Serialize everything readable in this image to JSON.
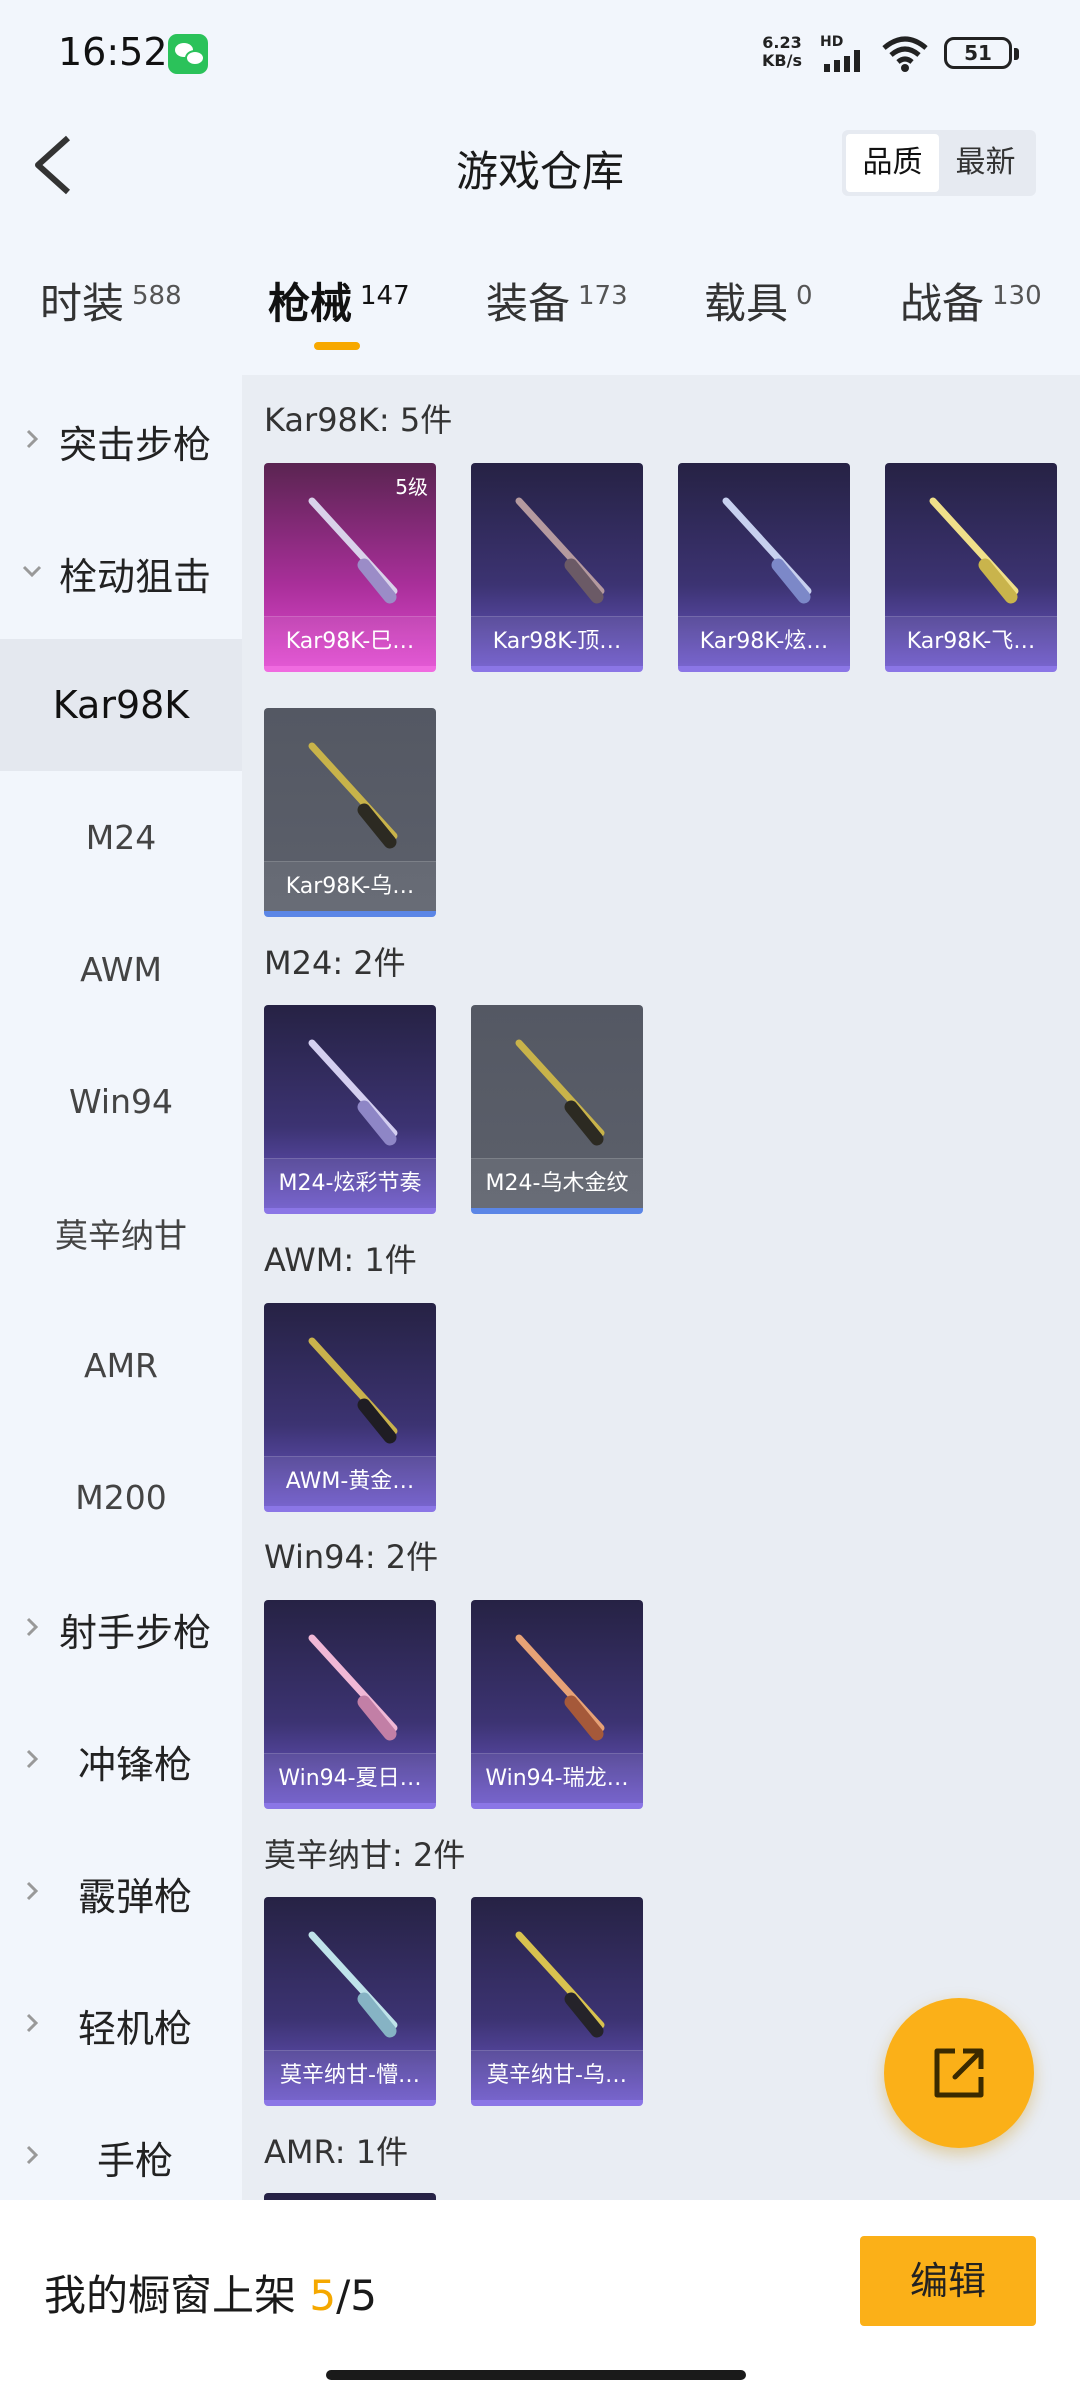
{
  "status_bar": {
    "time": "16:52",
    "net_speed_value": "6.23",
    "net_speed_unit": "KB/s",
    "hd_label": "HD",
    "battery": "51"
  },
  "header": {
    "title": "游戏仓库",
    "sort_options": [
      "品质",
      "最新"
    ]
  },
  "tabs": [
    {
      "label": "时装",
      "count": "588"
    },
    {
      "label": "枪械",
      "count": "147"
    },
    {
      "label": "装备",
      "count": "173"
    },
    {
      "label": "载具",
      "count": "0"
    },
    {
      "label": "战备",
      "count": "130"
    }
  ],
  "sidebar": {
    "items": [
      {
        "label": "突击步枪"
      },
      {
        "label": "栓动狙击"
      },
      {
        "label": "Kar98K"
      },
      {
        "label": "M24"
      },
      {
        "label": "AWM"
      },
      {
        "label": "Win94"
      },
      {
        "label": "莫辛纳甘"
      },
      {
        "label": "AMR"
      },
      {
        "label": "M200"
      },
      {
        "label": "射手步枪"
      },
      {
        "label": "冲锋枪"
      },
      {
        "label": "霰弹枪"
      },
      {
        "label": "轻机枪"
      },
      {
        "label": "手枪"
      }
    ]
  },
  "sections": [
    {
      "title": "Kar98K: 5件",
      "items": [
        {
          "label": "Kar98K-巳…",
          "badge": "5级"
        },
        {
          "label": "Kar98K-顶…"
        },
        {
          "label": "Kar98K-炫…"
        },
        {
          "label": "Kar98K-飞…"
        },
        {
          "label": "Kar98K-乌…"
        }
      ]
    },
    {
      "title": "M24: 2件",
      "items": [
        {
          "label": "M24-炫彩节奏"
        },
        {
          "label": "M24-乌木金纹"
        }
      ]
    },
    {
      "title": "AWM: 1件",
      "items": [
        {
          "label": "AWM-黄金…"
        }
      ]
    },
    {
      "title": "Win94: 2件",
      "items": [
        {
          "label": "Win94-夏日…"
        },
        {
          "label": "Win94-瑞龙…"
        }
      ]
    },
    {
      "title": "莫辛纳甘: 2件",
      "items": [
        {
          "label": "莫辛纳甘-懵…"
        },
        {
          "label": "莫辛纳甘-乌…"
        }
      ]
    },
    {
      "title": "AMR: 1件",
      "items": []
    }
  ],
  "bottom_bar": {
    "showcase_label": "我的橱窗上架",
    "showcase_current": "5",
    "showcase_total": "/5",
    "edit_label": "编辑"
  },
  "colors": {
    "accent": "#fbb018",
    "purple_card": "#3c3372",
    "pink_card": "#a92f9a",
    "grey_card": "#5c606b"
  }
}
